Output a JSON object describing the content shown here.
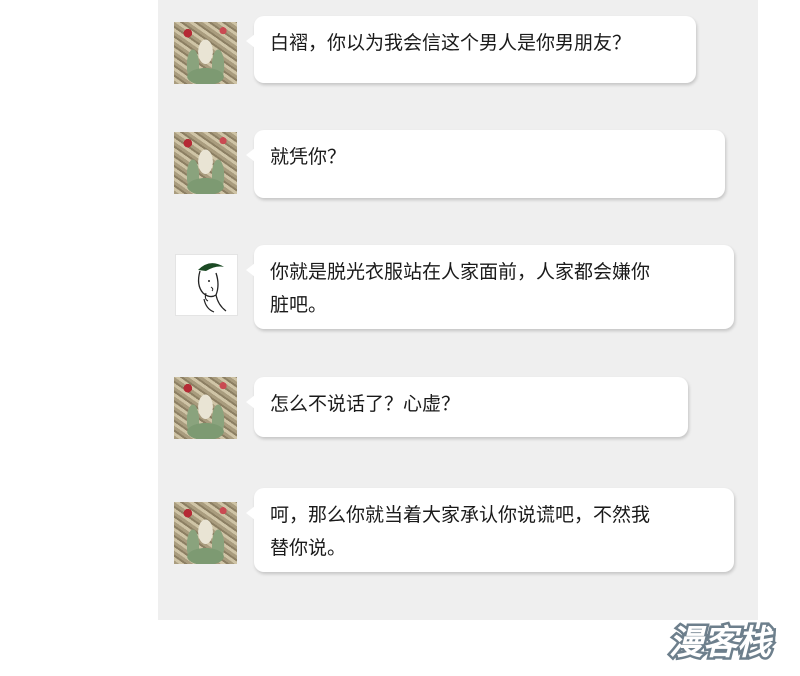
{
  "messages": [
    {
      "sender": "painting",
      "text": "白褶，你以为我会信这个男人是你男朋友？"
    },
    {
      "sender": "painting",
      "text": "就凭你？"
    },
    {
      "sender": "sketch",
      "text": "你就是脱光衣服站在人家面前，人家都会嫌你\n脏吧。"
    },
    {
      "sender": "painting",
      "text": "怎么不说话了？心虚？"
    },
    {
      "sender": "painting",
      "text": "呵，那么你就当着大家承认你说谎吧，不然我\n替你说。"
    }
  ],
  "watermark": {
    "text": "漫客栈"
  },
  "colors": {
    "panel": "#efefef",
    "bubble": "#ffffff",
    "text": "#1a1a1a",
    "watermark": "#6d7f8c"
  }
}
